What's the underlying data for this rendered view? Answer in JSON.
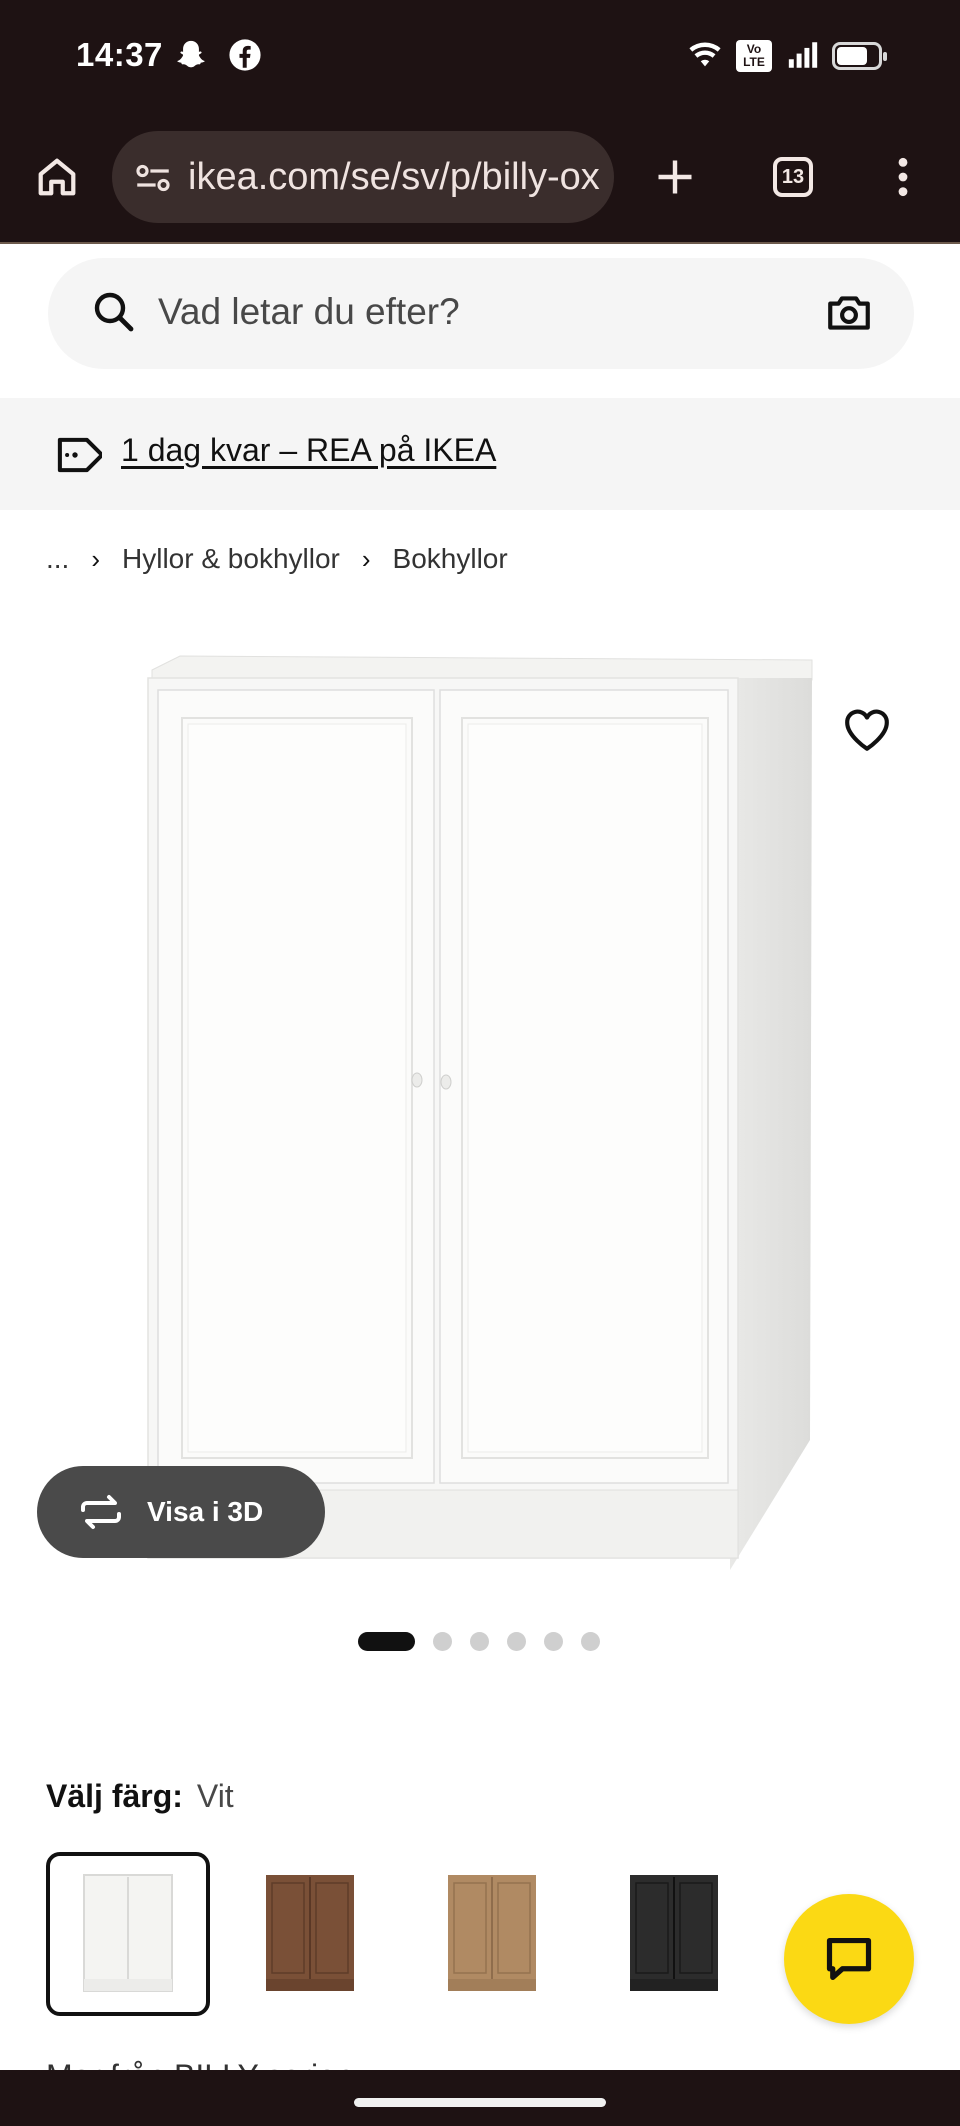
{
  "status_bar": {
    "time": "14:37",
    "icons": [
      "snapchat-icon",
      "facebook-icon",
      "wifi-icon",
      "volte-icon",
      "signal-icon",
      "battery-icon"
    ]
  },
  "browser": {
    "url": "ikea.com/se/sv/p/billy-ox",
    "tab_count": "13",
    "icons": [
      "home-icon",
      "site-settings-icon",
      "new-tab-icon",
      "tabs-icon",
      "menu-icon"
    ]
  },
  "search": {
    "placeholder": "Vad letar du efter?"
  },
  "promo": {
    "text": "1 dag kvar – REA på IKEA"
  },
  "breadcrumb": {
    "items": [
      "...",
      "Hyllor & bokhyllor",
      "Bokhyllor"
    ]
  },
  "product": {
    "view3d_label": "Visa i 3D",
    "image_count": 6,
    "active_image": 1
  },
  "color": {
    "label": "Välj färg:",
    "selected": "Vit",
    "swatches": [
      {
        "name": "vit",
        "color": "#f4f4f2",
        "selected": true
      },
      {
        "name": "brun",
        "color": "#7a5037",
        "selected": false
      },
      {
        "name": "ek",
        "color": "#b08a63",
        "selected": false
      },
      {
        "name": "svart",
        "color": "#2c2c2c",
        "selected": false
      }
    ]
  },
  "peek": {
    "text": "Mer från BILLY-serien"
  },
  "colors": {
    "chrome_bg": "#1e1213",
    "chat_yellow": "#fbd914"
  }
}
